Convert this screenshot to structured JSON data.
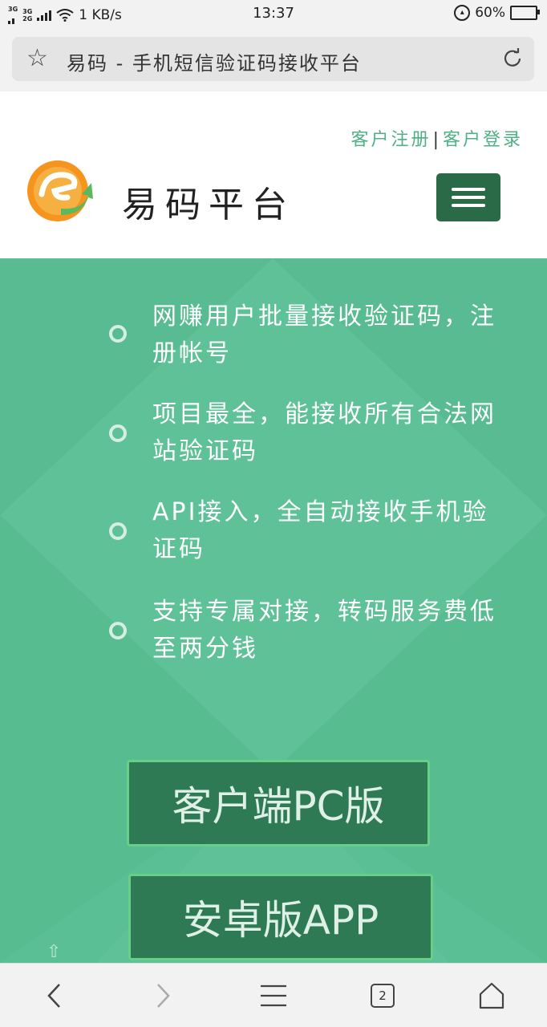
{
  "status_bar": {
    "net1": "3G",
    "net2_top": "3G",
    "net2_bottom": "2G",
    "speed": "1 KB/s",
    "time": "13:37",
    "battery_text": "60%",
    "battery_level": 0.6
  },
  "browser": {
    "page_title": "易码 - 手机短信验证码接收平台",
    "tab_count": "2"
  },
  "header": {
    "register_link": "客户注册",
    "separator": "|",
    "login_link": "客户登录",
    "site_name": "易码平台"
  },
  "hero": {
    "features": [
      "网赚用户批量接收验证码，注册帐号",
      "项目最全，能接收所有合法网站验证码",
      "API接入，全自动接收手机验证码",
      "支持专属对接，转码服务费低至两分钱"
    ],
    "buttons": {
      "pc_client": "客户端PC版",
      "android_app": "安卓版APP"
    }
  },
  "colors": {
    "brand_green": "#5bbf95",
    "dark_green": "#2b6a47",
    "link_green": "#4fb085"
  },
  "icons": {
    "bookmark": "star-icon",
    "refresh": "refresh-icon",
    "back": "chevron-left-icon",
    "forward": "chevron-right-icon",
    "menu": "menu-icon",
    "tabs": "tabs-icon",
    "home": "home-icon"
  }
}
